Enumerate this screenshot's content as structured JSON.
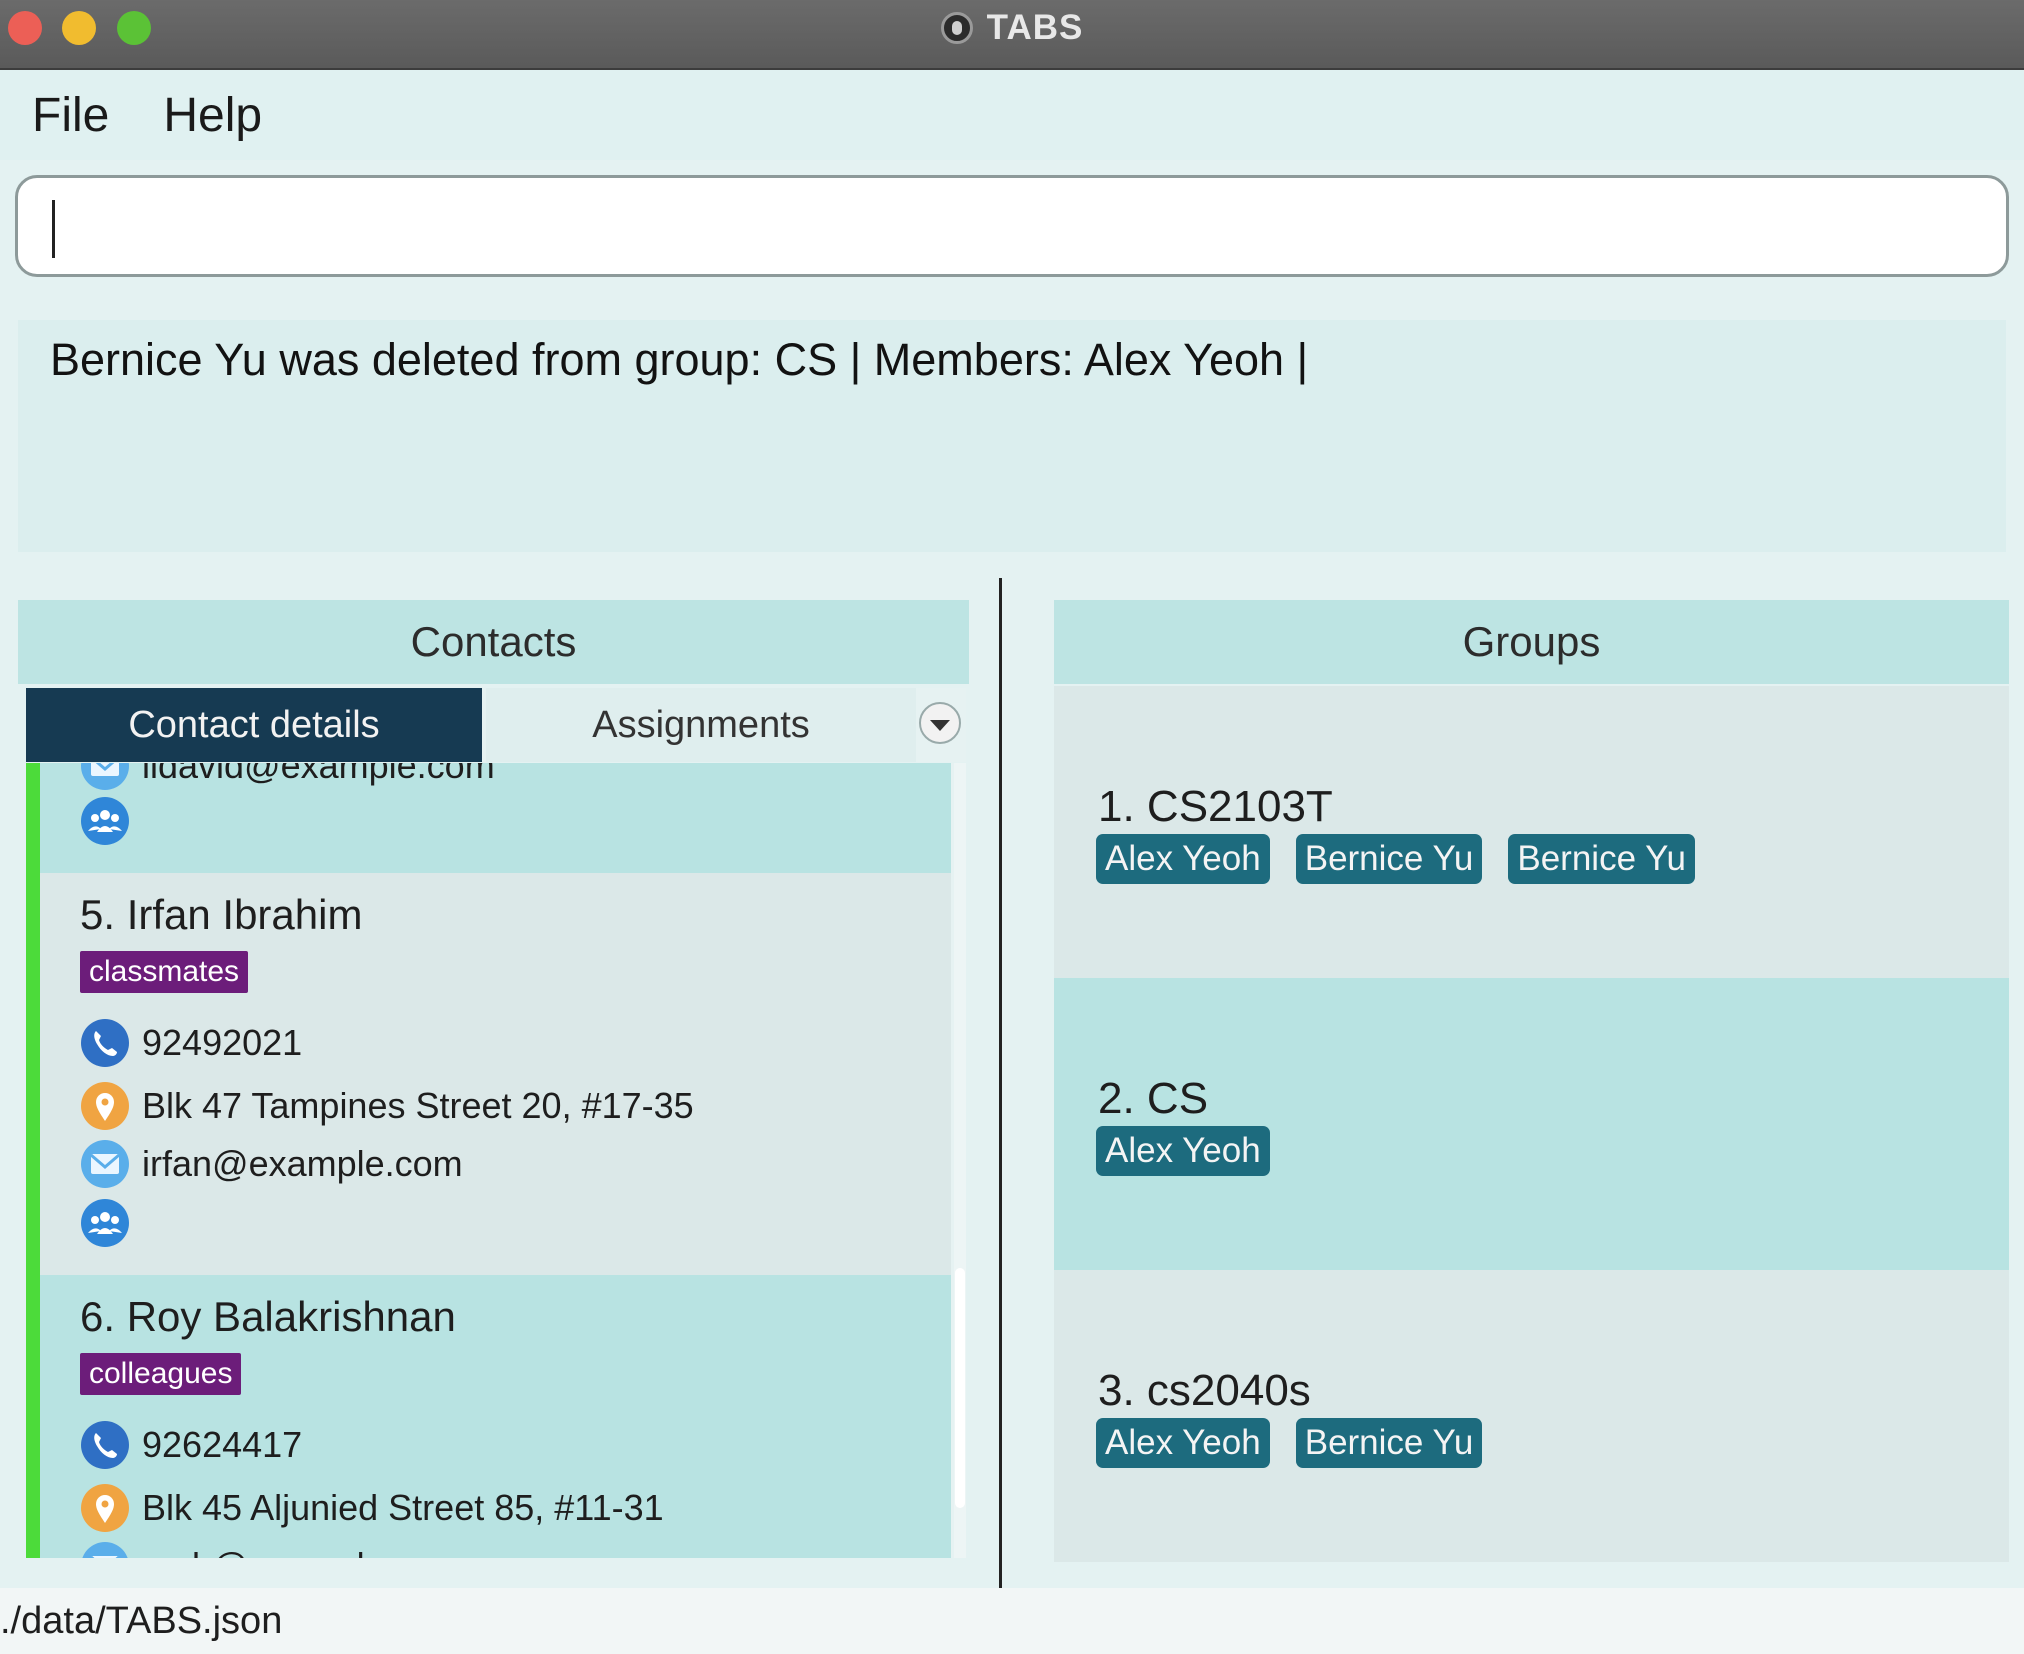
{
  "window": {
    "title": "TABS"
  },
  "menu": {
    "file": "File",
    "help": "Help"
  },
  "command": {
    "value": "",
    "placeholder": ""
  },
  "result": {
    "message": "Bernice Yu was deleted from group: CS | Members: Alex Yeoh |"
  },
  "contacts": {
    "header": "Contacts",
    "tabs": {
      "active": "Contact details",
      "inactive": "Assignments"
    },
    "partial_top_email": "lidavid@example.com",
    "items": [
      {
        "title": "5.  Irfan Ibrahim",
        "tag": "classmates",
        "phone": "92492021",
        "address": "Blk 47 Tampines Street 20, #17-35",
        "email": "irfan@example.com"
      },
      {
        "title": "6.  Roy Balakrishnan",
        "tag": "colleagues",
        "phone": "92624417",
        "address": "Blk 45 Aljunied Street 85, #11-31",
        "email": "royb@example.com"
      }
    ]
  },
  "groups": {
    "header": "Groups",
    "items": [
      {
        "title": "1.  CS2103T",
        "members": [
          "Alex Yeoh",
          "Bernice Yu",
          "Bernice Yu"
        ]
      },
      {
        "title": "2.  CS",
        "members": [
          "Alex Yeoh"
        ]
      },
      {
        "title": "3.  cs2040s",
        "members": [
          "Alex Yeoh",
          "Bernice Yu"
        ]
      }
    ]
  },
  "status": {
    "path": "./data/TABS.json"
  },
  "colors": {
    "tag": "#6c1d7a",
    "member_chip": "#1d6b7e",
    "active_tab": "#163a52",
    "accent_green": "#4cdb3a",
    "panel_header": "#bde4e3"
  },
  "icons": {
    "phone": "phone-icon",
    "address": "location-pin-icon",
    "email": "email-icon",
    "group": "group-icon",
    "dropdown": "chevron-down-icon"
  }
}
